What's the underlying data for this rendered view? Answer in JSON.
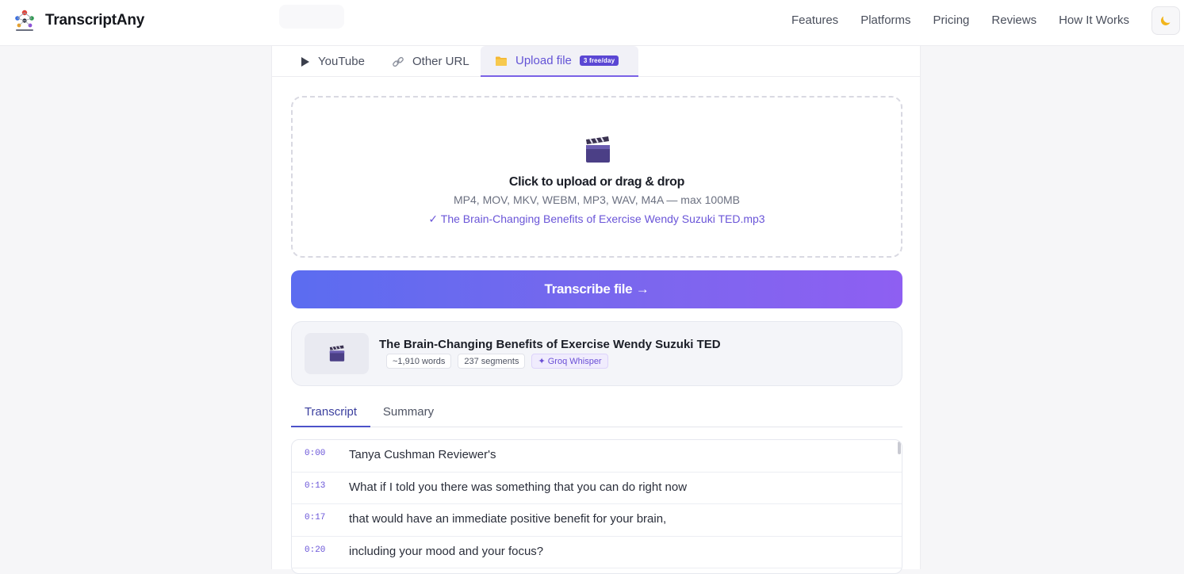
{
  "brand": {
    "name": "TranscriptAny",
    "logo_icon": "people-network-icon"
  },
  "nav": {
    "links": [
      "Features",
      "Platforms",
      "Pricing",
      "Reviews",
      "How It Works"
    ],
    "theme_icon": "moon-icon"
  },
  "source_tabs": [
    {
      "label": "YouTube",
      "icon": "play-icon",
      "active": false
    },
    {
      "label": "Other URL",
      "icon": "link-icon",
      "active": false
    },
    {
      "label": "Upload file",
      "icon": "folder-icon",
      "active": true,
      "badge": "3 free/day"
    }
  ],
  "upload": {
    "icon": "clapperboard-icon",
    "title": "Click to upload or drag & drop",
    "formats": "MP4, MOV, MKV, WEBM, MP3, WAV, M4A — max 100MB",
    "selected_file": "✓ The Brain-Changing Benefits of Exercise Wendy Suzuki TED.mp3"
  },
  "transcribe_button": "Transcribe file →",
  "result": {
    "thumb_icon": "clapperboard-icon",
    "title": "The Brain-Changing Benefits of Exercise Wendy Suzuki TED",
    "words": "~1,910 words",
    "segments": "237 segments",
    "engine": "✦ Groq Whisper"
  },
  "output_tabs": [
    {
      "label": "Transcript",
      "active": true
    },
    {
      "label": "Summary",
      "active": false
    }
  ],
  "transcript": [
    {
      "time": "0:00",
      "text": "Tanya Cushman Reviewer's"
    },
    {
      "time": "0:13",
      "text": "What if I told you there was something that you can do right now"
    },
    {
      "time": "0:17",
      "text": "that would have an immediate positive benefit for your brain,"
    },
    {
      "time": "0:20",
      "text": "including your mood and your focus?"
    }
  ],
  "colors": {
    "accent": "#6a55d8",
    "button_start": "#5b6cf0",
    "button_end": "#8e5ff2"
  }
}
